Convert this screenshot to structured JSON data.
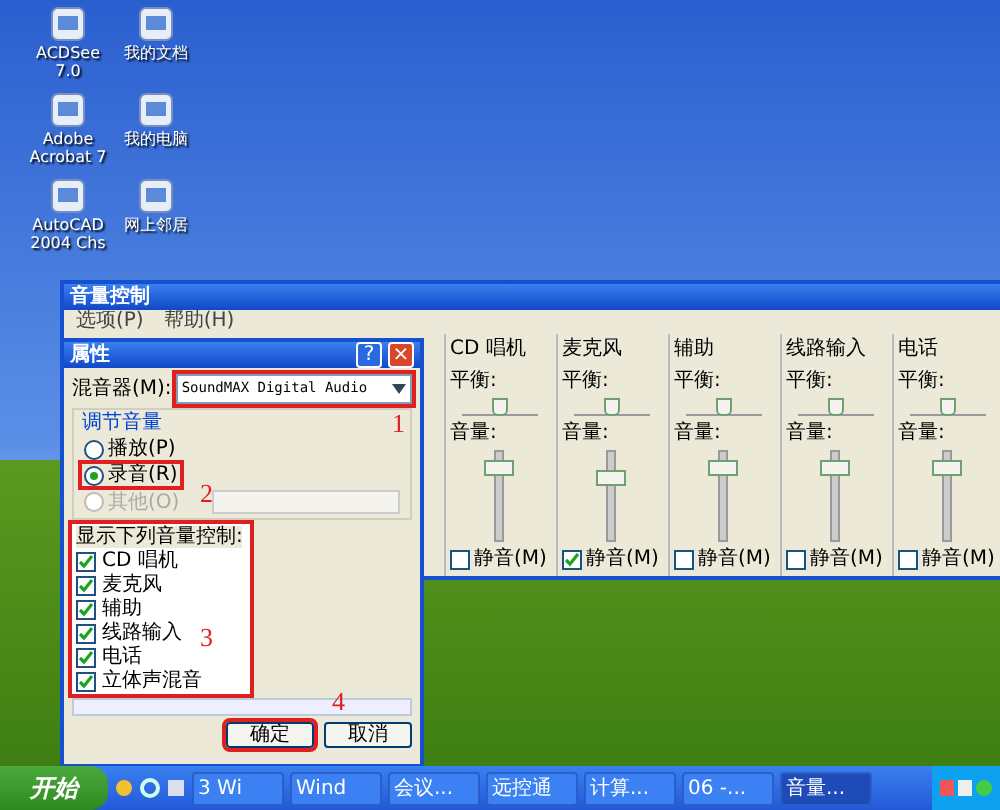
{
  "desktop_icons": [
    {
      "label": "ACDSee 7.0"
    },
    {
      "label": "我的文档"
    },
    {
      "label": "Adobe Acrobat 7"
    },
    {
      "label": "我的电脑"
    },
    {
      "label": "AutoCAD 2004 Chs"
    },
    {
      "label": "网上邻居"
    }
  ],
  "mixer_window": {
    "title": "音量控制",
    "menu": [
      "选项(P)",
      "帮助(H)"
    ],
    "channels": [
      {
        "name": "CD 唱机",
        "balance_label": "平衡:",
        "balance": {
          "level": 0.5
        },
        "volume_label": "音量:",
        "level": 0.9,
        "mute_label": "静音(M)",
        "muted": false
      },
      {
        "name": "麦克风",
        "balance_label": "平衡:",
        "balance": {
          "level": 0.5
        },
        "volume_label": "音量:",
        "level": 0.75,
        "mute_label": "静音(M)",
        "muted": true
      },
      {
        "name": "辅助",
        "balance_label": "平衡:",
        "balance": {
          "level": 0.5
        },
        "volume_label": "音量:",
        "level": 0.9,
        "mute_label": "静音(M)",
        "muted": false
      },
      {
        "name": "线路输入",
        "balance_label": "平衡:",
        "balance": {
          "level": 0.5
        },
        "volume_label": "音量:",
        "level": 0.9,
        "mute_label": "静音(M)",
        "muted": false
      },
      {
        "name": "电话",
        "balance_label": "平衡:",
        "balance": {
          "level": 0.5
        },
        "volume_label": "音量:",
        "level": 0.9,
        "mute_label": "静音(M)",
        "muted": false
      }
    ]
  },
  "properties_dialog": {
    "title": "属性",
    "help_button": "?",
    "close_button": "×",
    "mixer_label": "混音器(M):",
    "mixer_value": "SoundMAX Digital Audio",
    "group_title": "调节音量",
    "radios": [
      {
        "label": "播放(P)",
        "selected": false,
        "disabled": false
      },
      {
        "label": "录音(R)",
        "selected": true,
        "disabled": false
      },
      {
        "label": "其他(O)",
        "selected": false,
        "disabled": true
      }
    ],
    "list_title": "显示下列音量控制:",
    "controls": [
      {
        "label": "CD 唱机",
        "checked": true
      },
      {
        "label": "麦克风",
        "checked": true
      },
      {
        "label": "辅助",
        "checked": true
      },
      {
        "label": "线路输入",
        "checked": true
      },
      {
        "label": "电话",
        "checked": true
      },
      {
        "label": "立体声混音",
        "checked": true
      }
    ],
    "buttons": [
      "确定",
      "取消"
    ]
  },
  "annotations": [
    "1",
    "2",
    "3",
    "4"
  ],
  "taskbar": {
    "start": "开始",
    "buttons": [
      {
        "label": "3 Wi",
        "selected": false
      },
      {
        "label": "Wind",
        "selected": false
      },
      {
        "label": "会议...",
        "selected": false
      },
      {
        "label": "远控通",
        "selected": false
      },
      {
        "label": "计算...",
        "selected": false
      },
      {
        "label": "06 -...",
        "selected": false
      },
      {
        "label": "音量...",
        "selected": true
      }
    ]
  }
}
